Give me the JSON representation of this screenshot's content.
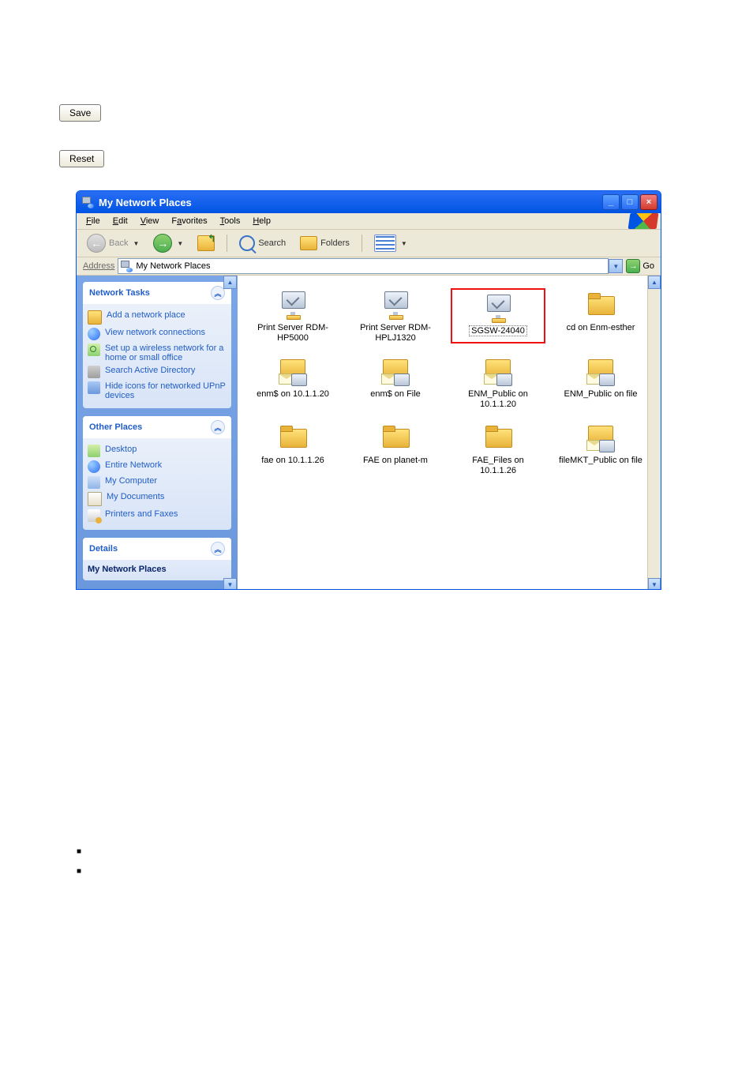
{
  "buttons": {
    "save": "Save",
    "reset": "Reset"
  },
  "window": {
    "title": "My Network Places",
    "win_min": "_",
    "win_max": "□",
    "win_close": "×"
  },
  "menubar": [
    "File",
    "Edit",
    "View",
    "Favorites",
    "Tools",
    "Help"
  ],
  "toolbar": {
    "back": "Back",
    "search": "Search",
    "folders": "Folders"
  },
  "address": {
    "label": "Address",
    "value": "My Network Places",
    "go": "Go"
  },
  "sidebar": {
    "network_tasks": {
      "title": "Network Tasks",
      "items": [
        "Add a network place",
        "View network connections",
        "Set up a wireless network for a home or small office",
        "Search Active Directory",
        "Hide icons for networked UPnP devices"
      ]
    },
    "other_places": {
      "title": "Other Places",
      "items": [
        "Desktop",
        "Entire Network",
        "My Computer",
        "My Documents",
        "Printers and Faxes"
      ]
    },
    "details": {
      "title": "Details",
      "text": "My Network Places"
    }
  },
  "items": [
    {
      "label": "Print Server RDM-HP5000",
      "icon": "monitor",
      "selected": false
    },
    {
      "label": "Print Server RDM-HPLJ1320",
      "icon": "monitor",
      "selected": false
    },
    {
      "label": "SGSW-24040",
      "icon": "monitor",
      "selected": true
    },
    {
      "label": "cd on Enm-esther",
      "icon": "folder",
      "selected": false
    },
    {
      "label": "enm$ on 10.1.1.20",
      "icon": "netfolder",
      "selected": false
    },
    {
      "label": "enm$ on File",
      "icon": "netfolder",
      "selected": false
    },
    {
      "label": "ENM_Public on 10.1.1.20",
      "icon": "netfolder",
      "selected": false
    },
    {
      "label": "ENM_Public on file",
      "icon": "netfolder",
      "selected": false
    },
    {
      "label": "fae on 10.1.1.26",
      "icon": "folder",
      "selected": false
    },
    {
      "label": "FAE on planet-m",
      "icon": "folder",
      "selected": false
    },
    {
      "label": "FAE_Files on 10.1.1.26",
      "icon": "folder",
      "selected": false
    },
    {
      "label": "fileMKT_Public on file",
      "icon": "netfolder",
      "selected": false
    }
  ]
}
